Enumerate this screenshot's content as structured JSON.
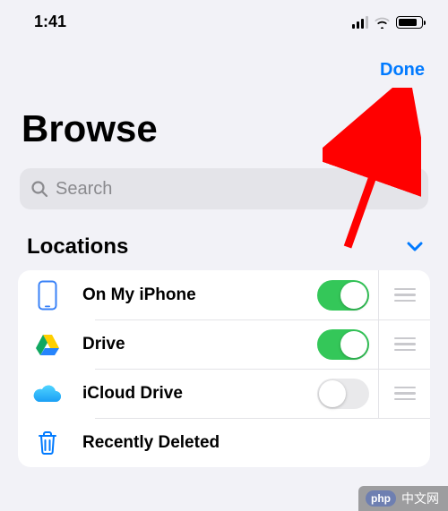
{
  "status": {
    "time": "1:41"
  },
  "nav": {
    "done": "Done"
  },
  "title": "Browse",
  "search": {
    "placeholder": "Search"
  },
  "section": {
    "label": "Locations"
  },
  "rows": [
    {
      "label": "On My iPhone",
      "toggle": true,
      "drag": true,
      "icon": "iphone"
    },
    {
      "label": "Drive",
      "toggle": true,
      "drag": true,
      "icon": "gdrive"
    },
    {
      "label": "iCloud Drive",
      "toggle": false,
      "drag": true,
      "icon": "icloud"
    },
    {
      "label": "Recently Deleted",
      "icon": "trash"
    }
  ],
  "watermark": {
    "badge": "php",
    "text": "中文网"
  },
  "colors": {
    "accent": "#007aff",
    "toggle_on": "#34c759"
  }
}
